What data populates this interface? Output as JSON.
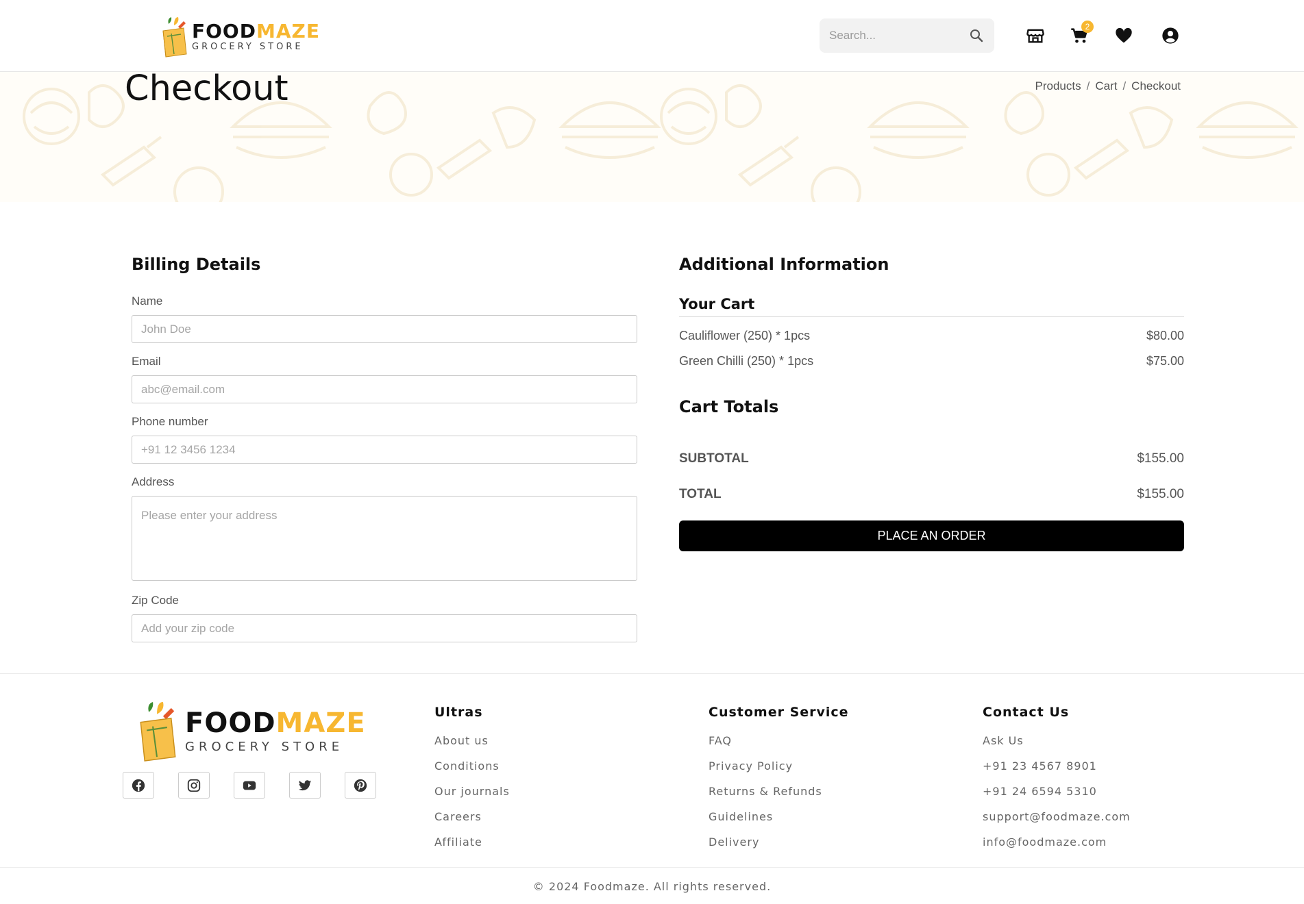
{
  "header": {
    "logo_word_1": "FOOD",
    "logo_word_2": "MAZE",
    "logo_tagline": "GROCERY STORE",
    "search_placeholder": "Search...",
    "cart_count": "2",
    "icons": [
      "store-icon",
      "cart-icon",
      "heart-icon",
      "user-account-icon",
      "search-icon"
    ]
  },
  "banner": {
    "title": "Checkout",
    "breadcrumb": [
      "Products",
      "Cart",
      "Checkout"
    ],
    "separator": "/"
  },
  "billing": {
    "title": "Billing Details",
    "fields": [
      {
        "label": "Name",
        "placeholder": "John Doe"
      },
      {
        "label": "Email",
        "placeholder": "abc@email.com"
      },
      {
        "label": "Phone number",
        "placeholder": "+91 12 3456 1234"
      },
      {
        "label": "Address",
        "placeholder": "Please enter your address"
      },
      {
        "label": "Zip Code",
        "placeholder": "Add your zip code"
      }
    ]
  },
  "additional": {
    "title": "Additional Information",
    "cart_title": "Your Cart",
    "cart_items": [
      {
        "name": "Cauliflower (250) * 1pcs",
        "price": "$80.00"
      },
      {
        "name": "Green Chilli (250) * 1pcs",
        "price": "$75.00"
      }
    ],
    "totals_title": "Cart Totals",
    "subtotal_label": "SUBTOTAL",
    "subtotal_value": "$155.00",
    "total_label": "TOTAL",
    "total_value": "$155.00",
    "order_button": "PLACE AN ORDER"
  },
  "footer": {
    "logo_word_1": "FOOD",
    "logo_word_2": "MAZE",
    "logo_tagline": "GROCERY STORE",
    "social": [
      "facebook-icon",
      "instagram-icon",
      "youtube-icon",
      "twitter-icon",
      "pinterest-icon"
    ],
    "columns": [
      {
        "title": "Ultras",
        "links": [
          "About us",
          "Conditions",
          "Our journals",
          "Careers",
          "Affiliate"
        ]
      },
      {
        "title": "Customer Service",
        "links": [
          "FAQ",
          "Privacy Policy",
          "Returns & Refunds",
          "Guidelines",
          "Delivery"
        ]
      },
      {
        "title": "Contact Us",
        "links": [
          "Ask Us",
          "+91 23 4567 8901",
          "+91 24 6594 5310",
          "support@foodmaze.com",
          "info@foodmaze.com"
        ]
      }
    ],
    "copyright": "© 2024 Foodmaze. All rights reserved."
  },
  "colors": {
    "brand_yellow": "#f7b731",
    "button_black": "#000000",
    "banner_bg": "#fffdf8"
  }
}
